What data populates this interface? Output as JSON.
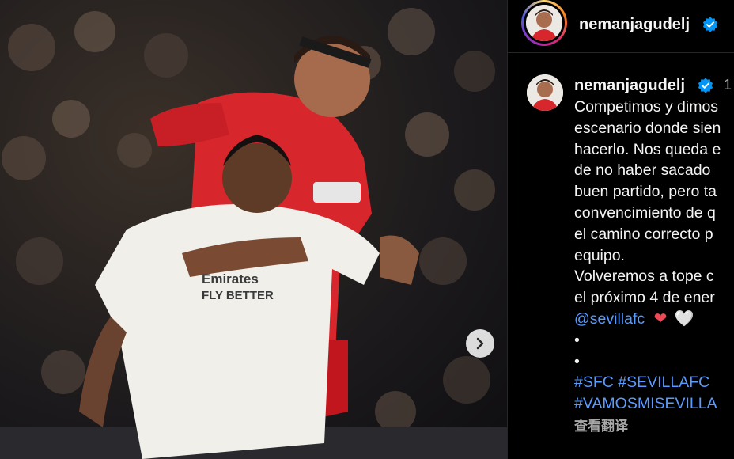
{
  "post": {
    "image_alt": "Football match photo",
    "next_icon": "chevron-right-icon"
  },
  "header": {
    "username": "nemanjagudelj",
    "verified_icon": "verified-badge-icon"
  },
  "comment": {
    "username": "nemanjagudelj",
    "time": "1",
    "caption_lines": [
      "Competimos y dimos",
      "escenario donde sien",
      "hacerlo. Nos queda e",
      "de no haber sacado",
      "buen partido, pero ta",
      "convencimiento de q",
      "el camino correcto p",
      "equipo.",
      "Volveremos a tope c",
      "el próximo 4 de ener"
    ],
    "mention": "@sevillafc",
    "hearts": [
      "❤",
      "🤍"
    ],
    "bullets": [
      "•",
      "•"
    ],
    "hashtags_line1": "#SFC #SEVILLAFC",
    "hashtags_line2": "#VAMOSMISEVILLA",
    "see_translation": "查看翻译"
  },
  "colors": {
    "background": "#000000",
    "hashtag": "#5b9bff",
    "heart_red": "#ed4956",
    "verified": "#0095f6",
    "muted": "#a8a8a8"
  }
}
